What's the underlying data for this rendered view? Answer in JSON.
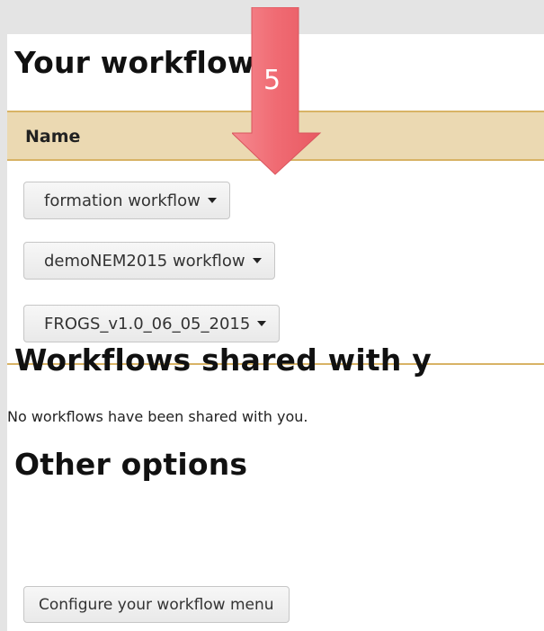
{
  "annotation": {
    "step_number": "5",
    "arrow_color": "#f06b73"
  },
  "workflows": {
    "title": "Your workflows",
    "column_name": "Name",
    "items": [
      {
        "label": "formation workflow"
      },
      {
        "label": "demoNEM2015 workflow"
      },
      {
        "label": "FROGS_v1.0_06_05_2015"
      }
    ]
  },
  "shared": {
    "title": "Workflows shared with y",
    "empty_message": "No workflows have been shared with you."
  },
  "options": {
    "title": "Other options",
    "configure_label": "Configure your workflow menu"
  },
  "colors": {
    "header_bg": "#ebd9b2",
    "header_border": "#d8b365",
    "page_bg": "#e4e4e4"
  }
}
